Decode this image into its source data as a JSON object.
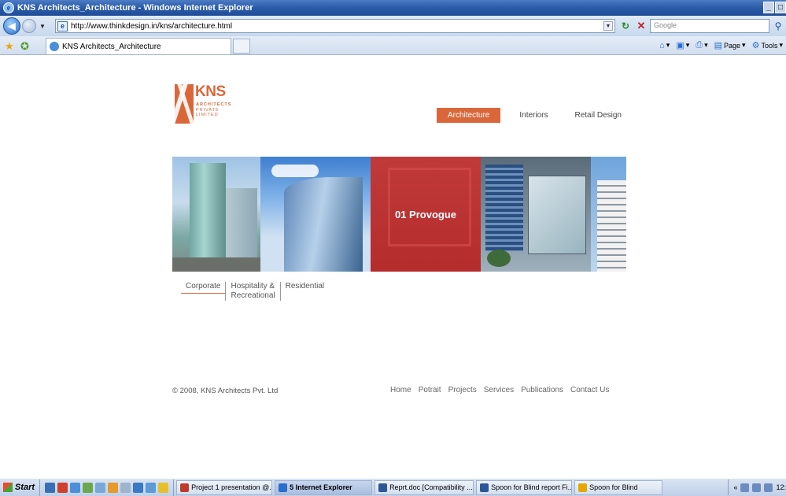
{
  "window": {
    "title": "KNS Architects_Architecture - Windows Internet Explorer",
    "controls": [
      "_",
      "□"
    ]
  },
  "address_bar": {
    "url": "http://www.thinkdesign.in/kns/architecture.html",
    "search_placeholder": "Google"
  },
  "tab_bar": {
    "active_tab": "KNS Architects_Architecture",
    "commands": {
      "page": "Page",
      "tools": "Tools"
    }
  },
  "site": {
    "logo": {
      "name": "KNS",
      "sub_lines": [
        "ARCHITECTS",
        "PRIVATE",
        "LIMITED"
      ]
    },
    "nav": [
      {
        "label": "Architecture",
        "active": true
      },
      {
        "label": "Interiors",
        "active": false
      },
      {
        "label": "Retail Design",
        "active": false
      }
    ],
    "gallery": {
      "caption": "01 Provogue"
    },
    "subnav": [
      {
        "label": "Corporate",
        "active": true
      },
      {
        "label": "Hospitality &\nRecreational",
        "active": false
      },
      {
        "label": "Residential",
        "active": false
      }
    ],
    "footer": {
      "copyright": "© 2008, KNS Architects Pvt. Ltd",
      "links": [
        "Home",
        "Potrait",
        "Projects",
        "Services",
        "Publications",
        "Contact Us"
      ]
    }
  },
  "taskbar": {
    "start": "Start",
    "tasks": [
      {
        "label": "Project 1 presentation @...",
        "active": false,
        "color": "#c0392b"
      },
      {
        "label": "5 Internet Explorer",
        "active": true,
        "color": "#2a6ccf"
      },
      {
        "label": "Reprt.doc [Compatibility ...",
        "active": false,
        "color": "#2b5797"
      },
      {
        "label": "Spoon for Blind report Fi...",
        "active": false,
        "color": "#2b5797"
      },
      {
        "label": "Spoon for Blind",
        "active": false,
        "color": "#e5a800"
      }
    ],
    "clock": "12:"
  },
  "colors": {
    "brand_orange": "#d9673a",
    "ie_blue": "#2a5aa8"
  }
}
